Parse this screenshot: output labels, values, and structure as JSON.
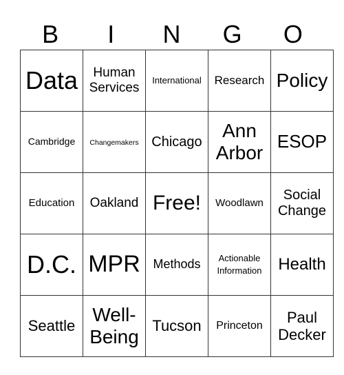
{
  "header": [
    "B",
    "I",
    "N",
    "G",
    "O"
  ],
  "rows": [
    [
      {
        "text": "Data",
        "size": 36
      },
      {
        "text": "Human Services",
        "size": 19
      },
      {
        "text": "International",
        "size": 13
      },
      {
        "text": "Research",
        "size": 17
      },
      {
        "text": "Policy",
        "size": 28
      }
    ],
    [
      {
        "text": "Cambridge",
        "size": 14
      },
      {
        "text": "Changemakers",
        "size": 10.5
      },
      {
        "text": "Chicago",
        "size": 20
      },
      {
        "text": "Ann Arbor",
        "size": 28
      },
      {
        "text": "ESOP",
        "size": 26
      }
    ],
    [
      {
        "text": "Education",
        "size": 15
      },
      {
        "text": "Oakland",
        "size": 19
      },
      {
        "text": "Free!",
        "size": 30
      },
      {
        "text": "Woodlawn",
        "size": 15
      },
      {
        "text": "Social Change",
        "size": 20
      }
    ],
    [
      {
        "text": "D.C.",
        "size": 36
      },
      {
        "text": "MPR",
        "size": 34
      },
      {
        "text": "Methods",
        "size": 18
      },
      {
        "text": "Actionable Information",
        "size": 13
      },
      {
        "text": "Health",
        "size": 24
      }
    ],
    [
      {
        "text": "Seattle",
        "size": 22
      },
      {
        "text": "Well-Being",
        "size": 28
      },
      {
        "text": "Tucson",
        "size": 22
      },
      {
        "text": "Princeton",
        "size": 16
      },
      {
        "text": "Paul Decker",
        "size": 22
      }
    ]
  ]
}
